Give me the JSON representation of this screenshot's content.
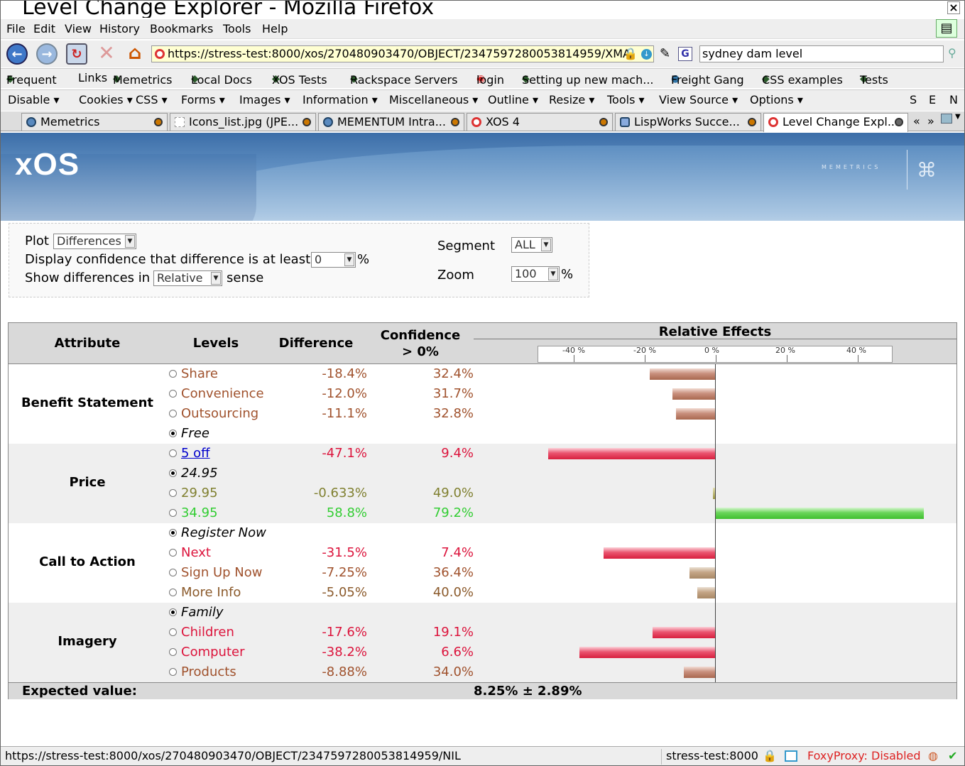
{
  "window": {
    "title": "Level Change Explorer - Mozilla Firefox",
    "close": "×"
  },
  "menu": [
    "File",
    "Edit",
    "View",
    "History",
    "Bookmarks",
    "Tools",
    "Help"
  ],
  "nav": {
    "url": "https://stress-test:8000/xos/270480903470/OBJECT/2347597280053814959/XMA",
    "search_value": "sydney dam level",
    "search_engine": "G"
  },
  "bookmarks": [
    "Frequent",
    "Links",
    "Memetrics",
    "Local Docs",
    "XOS Tests",
    "Rackspace Servers",
    "login",
    "Setting up new mach...",
    "Freight Gang",
    "CSS examples",
    "Tests"
  ],
  "devbar": {
    "items": [
      "Disable ▾",
      "Cookies ▾",
      "CSS ▾",
      "Forms ▾",
      "Images ▾",
      "Information ▾",
      "Miscellaneous ▾",
      "Outline ▾",
      "Resize ▾",
      "Tools ▾",
      "View Source ▾",
      "Options ▾"
    ],
    "flags": [
      "S",
      "E",
      "N"
    ]
  },
  "tabs": [
    "Memetrics",
    "Icons_list.jpg (JPE...",
    "MEMENTUM Intra...",
    "XOS 4",
    "LispWorks Succe...",
    "Level Change Expl..."
  ],
  "tab_scroll": {
    "left": "«",
    "right": "»"
  },
  "banner": {
    "logo": "xOS",
    "brand": "MEMETRICS",
    "mark": "⌘"
  },
  "controls": {
    "plot_label": "Plot",
    "plot_value": "Differences",
    "conf_label": "Display confidence that difference is at least",
    "conf_value": "0",
    "conf_unit": "%",
    "show_label": "Show differences in",
    "show_value": "Relative",
    "show_suffix": "sense",
    "segment_label": "Segment",
    "segment_value": "ALL",
    "zoom_label": "Zoom",
    "zoom_value": "100",
    "zoom_unit": "%"
  },
  "table": {
    "headers": {
      "attribute": "Attribute",
      "levels": "Levels",
      "difference": "Difference",
      "confidence": "Confidence",
      "confidence2": "> 0%",
      "effects": "Relative Effects"
    },
    "axis_ticks": [
      "-40 %",
      "-20 %",
      "0 %",
      "20 %",
      "40 %"
    ],
    "groups": [
      {
        "name": "Benefit Statement",
        "rows": [
          {
            "level": "Share",
            "diff": "-18.4%",
            "conf": "32.4%",
            "value": -18.4,
            "color": "#a0522d",
            "bar": "brown"
          },
          {
            "level": "Convenience",
            "diff": "-12.0%",
            "conf": "31.7%",
            "value": -12.0,
            "color": "#a0522d",
            "bar": "brown"
          },
          {
            "level": "Outsourcing",
            "diff": "-11.1%",
            "conf": "32.8%",
            "value": -11.1,
            "color": "#a0522d",
            "bar": "brown"
          },
          {
            "level": "Free",
            "diff": "",
            "conf": "",
            "value": 0,
            "base": true
          }
        ]
      },
      {
        "name": "Price",
        "rows": [
          {
            "level": "5 off",
            "diff": "-47.1%",
            "conf": "9.4%",
            "value": -47.1,
            "color": "#dc143c",
            "bar": "red",
            "link": true
          },
          {
            "level": "24.95",
            "diff": "",
            "conf": "",
            "value": 0,
            "base": true
          },
          {
            "level": "29.95",
            "diff": "-0.633%",
            "conf": "49.0%",
            "value": -0.633,
            "color": "#808030",
            "bar": "olive"
          },
          {
            "level": "34.95",
            "diff": "58.8%",
            "conf": "79.2%",
            "value": 58.8,
            "color": "#32cd32",
            "bar": "green"
          }
        ]
      },
      {
        "name": "Call to Action",
        "rows": [
          {
            "level": "Register Now",
            "diff": "",
            "conf": "",
            "value": 0,
            "base": true
          },
          {
            "level": "Next",
            "diff": "-31.5%",
            "conf": "7.4%",
            "value": -31.5,
            "color": "#dc143c",
            "bar": "red"
          },
          {
            "level": "Sign Up Now",
            "diff": "-7.25%",
            "conf": "36.4%",
            "value": -7.25,
            "color": "#a0522d",
            "bar": "tan"
          },
          {
            "level": "More Info",
            "diff": "-5.05%",
            "conf": "40.0%",
            "value": -5.05,
            "color": "#8b5a2b",
            "bar": "tan"
          }
        ]
      },
      {
        "name": "Imagery",
        "rows": [
          {
            "level": "Family",
            "diff": "",
            "conf": "",
            "value": 0,
            "base": true
          },
          {
            "level": "Children",
            "diff": "-17.6%",
            "conf": "19.1%",
            "value": -17.6,
            "color": "#dc143c",
            "bar": "red"
          },
          {
            "level": "Computer",
            "diff": "-38.2%",
            "conf": "6.6%",
            "value": -38.2,
            "color": "#dc143c",
            "bar": "red"
          },
          {
            "level": "Products",
            "diff": "-8.88%",
            "conf": "34.0%",
            "value": -8.88,
            "color": "#a0522d",
            "bar": "brown"
          }
        ]
      }
    ],
    "expected_label": "Expected value:",
    "expected_value": "8.25% ± 2.89%"
  },
  "status": {
    "url": "https://stress-test:8000/xos/270480903470/OBJECT/2347597280053814959/NIL",
    "host": "stress-test:8000",
    "foxy": "FoxyProxy: Disabled"
  }
}
